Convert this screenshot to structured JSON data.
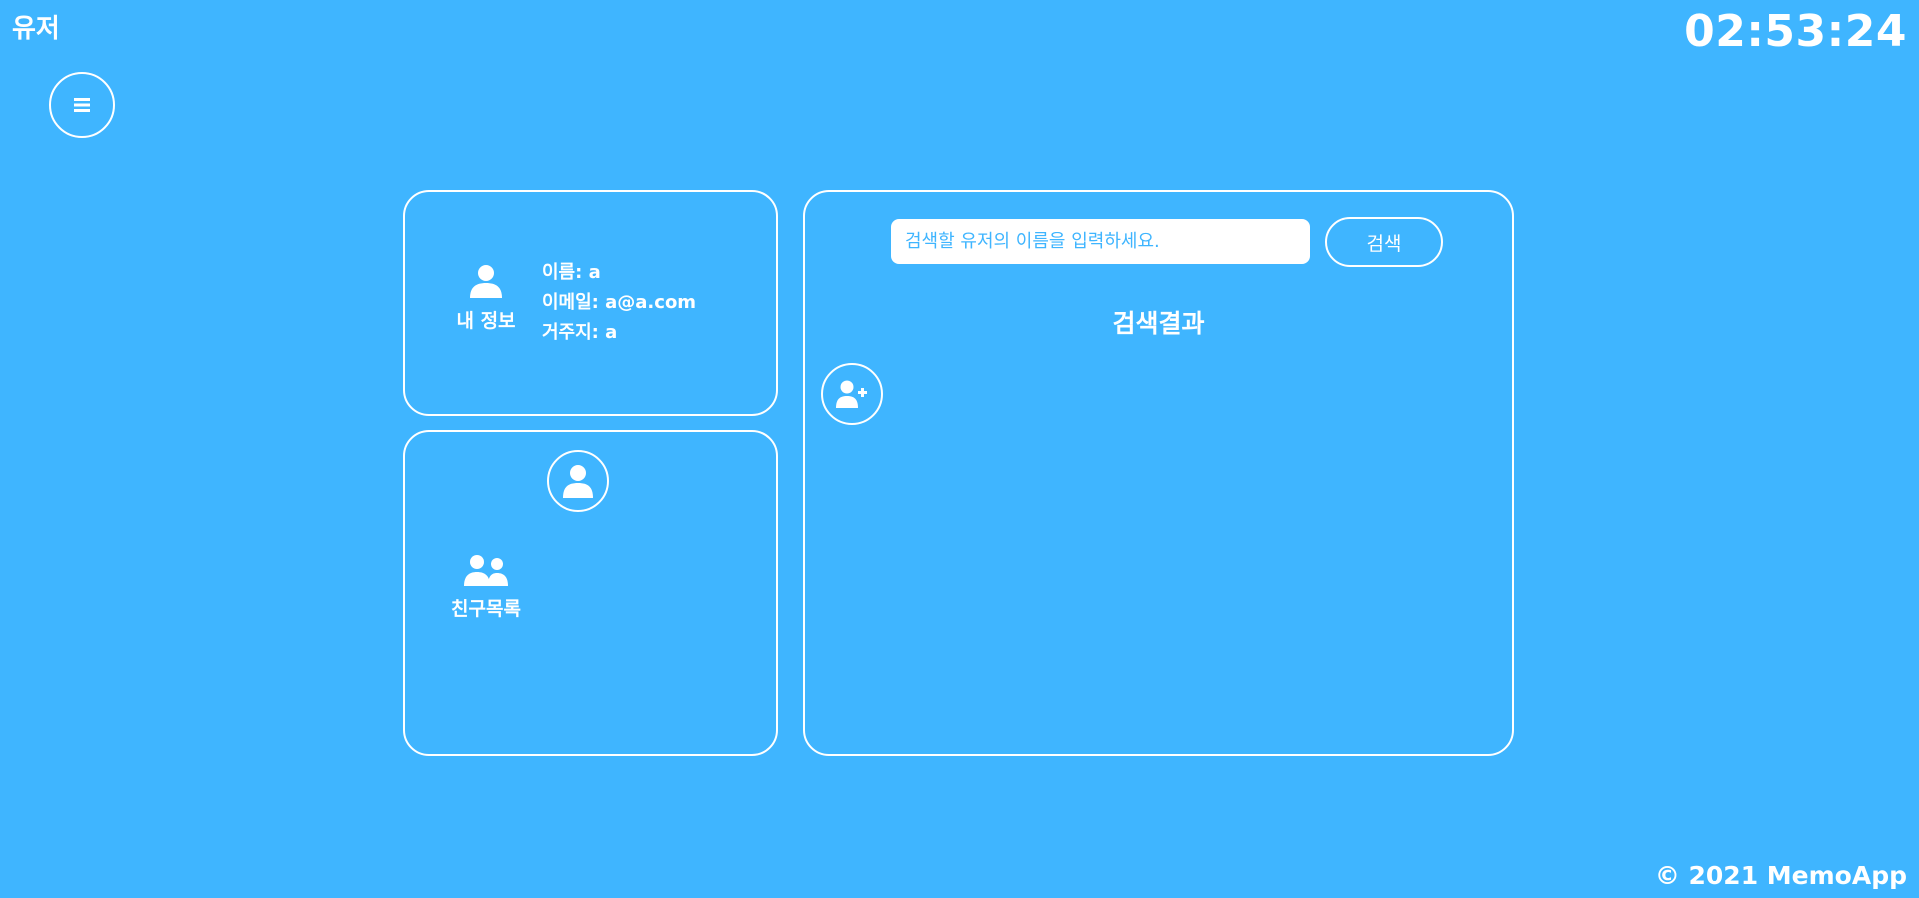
{
  "header": {
    "title": "유저",
    "clock": "02:53:24"
  },
  "menu": {
    "icon": "hamburger-icon"
  },
  "profile": {
    "label": "내 정보",
    "icon": "user-icon",
    "name_line": "이름: a",
    "email_line": "이메일: a@a.com",
    "address_line": "거주지: a"
  },
  "friends": {
    "label": "친구목록",
    "icon": "users-icon",
    "selected_icon": "user-icon"
  },
  "search": {
    "placeholder": "검색할 유저의 이름을 입력하세요.",
    "value": "",
    "button_label": "검색",
    "results_title": "검색결과",
    "add_icon": "user-plus-icon"
  },
  "footer": {
    "text": "© 2021 MemoApp"
  },
  "colors": {
    "background": "#3fb5ff",
    "foreground": "#ffffff"
  }
}
